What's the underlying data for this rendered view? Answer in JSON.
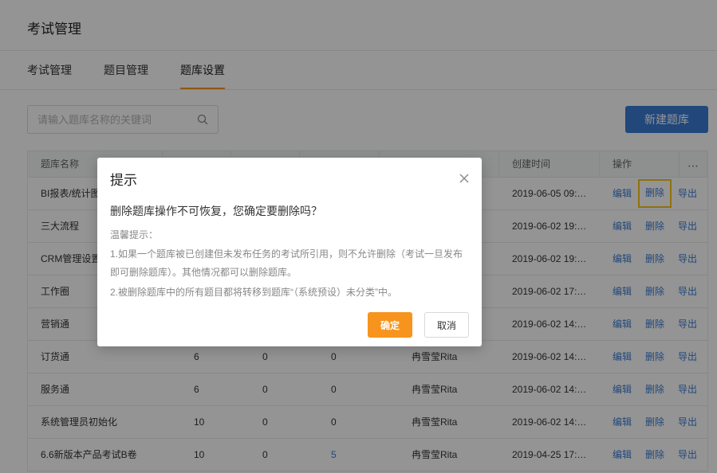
{
  "header": {
    "title": "考试管理"
  },
  "tabs": [
    {
      "label": "考试管理"
    },
    {
      "label": "题目管理"
    },
    {
      "label": "题库设置"
    }
  ],
  "toolbar": {
    "search_placeholder": "请输入题库名称的关键词",
    "new_label": "新建题库"
  },
  "table": {
    "headers": {
      "name": "题库名称",
      "created": "创建时间",
      "ops": "操作"
    },
    "actions": {
      "edit": "编辑",
      "delete": "删除",
      "export": "导出"
    },
    "rows": [
      {
        "name": "BI报表/统计图",
        "c1": "",
        "c2": "",
        "c3": "",
        "creator": "",
        "created": "2019-06-05 09:…"
      },
      {
        "name": "三大流程",
        "c1": "",
        "c2": "",
        "c3": "",
        "creator": "",
        "created": "2019-06-02 19:…"
      },
      {
        "name": "CRM管理设置",
        "c1": "",
        "c2": "",
        "c3": "",
        "creator": "",
        "created": "2019-06-02 19:…"
      },
      {
        "name": "工作圈",
        "c1": "",
        "c2": "",
        "c3": "",
        "creator": "",
        "created": "2019-06-02 17:…"
      },
      {
        "name": "营销通",
        "c1": "",
        "c2": "",
        "c3": "",
        "creator": "",
        "created": "2019-06-02 14:…"
      },
      {
        "name": "订货通",
        "c1": "6",
        "c2": "0",
        "c3": "0",
        "creator": "冉雪莹Rita",
        "created": "2019-06-02 14:…"
      },
      {
        "name": "服务通",
        "c1": "6",
        "c2": "0",
        "c3": "0",
        "creator": "冉雪莹Rita",
        "created": "2019-06-02 14:…"
      },
      {
        "name": "系统管理员初始化",
        "c1": "10",
        "c2": "0",
        "c3": "0",
        "creator": "冉雪莹Rita",
        "created": "2019-06-02 14:…"
      },
      {
        "name": "6.6新版本产品考试B卷",
        "c1": "10",
        "c2": "0",
        "c3": "5",
        "creator": "冉雪莹Rita",
        "created": "2019-04-25 17:…"
      }
    ]
  },
  "modal": {
    "title": "提示",
    "question": "删除题库操作不可恢复，您确定要删除吗？",
    "tip_header": "温馨提示：",
    "tip_line1": "1.如果一个题库被已创建但未发布任务的考试所引用，则不允许删除（考试一旦发布",
    "tip_line2": "即可删除题库）。其他情况都可以删除题库。",
    "tip_line3": "2.被删除题库中的所有题目都将转移到题库“（系统预设）未分类”中。",
    "ok_label": "确定",
    "cancel_label": "取消"
  },
  "colors": {
    "accent_orange": "#f7941d",
    "primary_blue": "#3a7bd5",
    "highlight_yellow": "#f5c518"
  }
}
